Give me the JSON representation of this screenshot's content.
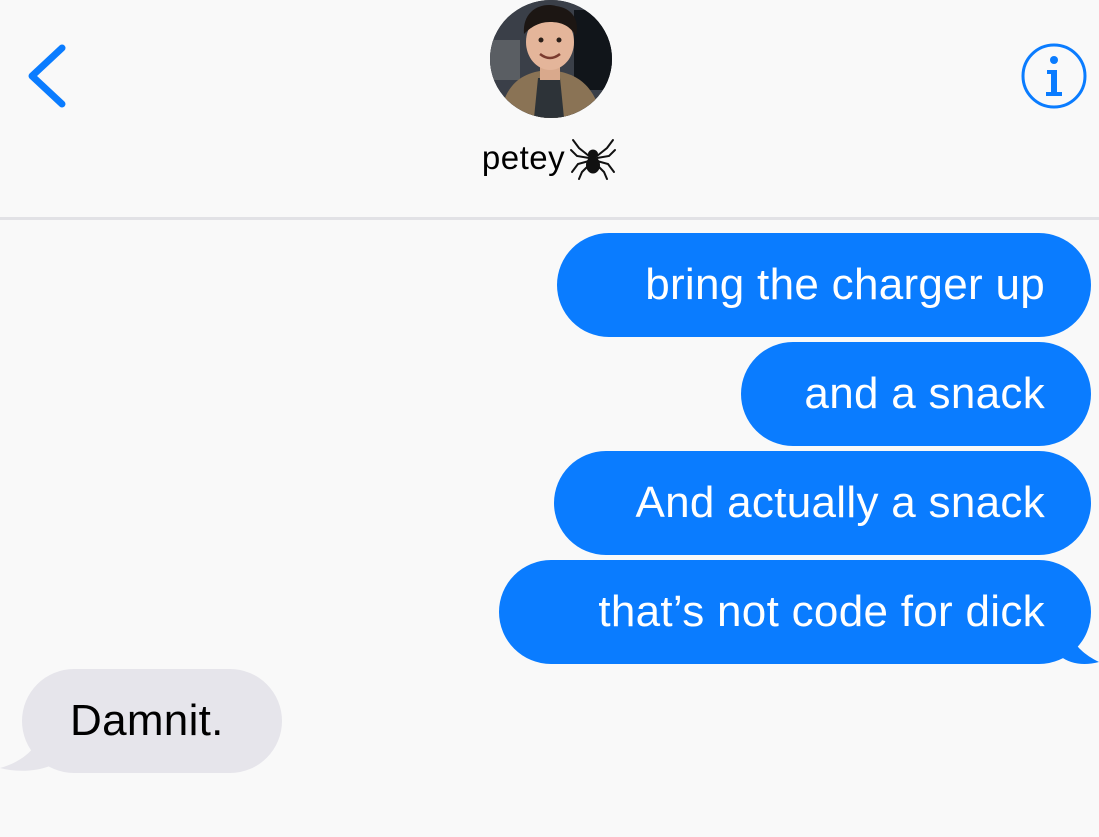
{
  "header": {
    "contact_name": "petey",
    "contact_emoji": "spider-emoji",
    "back_icon": "chevron-left-icon",
    "info_icon": "info-icon",
    "accent_color": "#0a7cff"
  },
  "messages": [
    {
      "direction": "outgoing",
      "text": "bring the charger up"
    },
    {
      "direction": "outgoing",
      "text": "and a snack"
    },
    {
      "direction": "outgoing",
      "text": "And actually a snack"
    },
    {
      "direction": "outgoing",
      "text": "that’s not code for dick"
    },
    {
      "direction": "incoming",
      "text": "Damnit."
    }
  ],
  "colors": {
    "outgoing_bubble": "#0a7cff",
    "incoming_bubble": "#e6e5eb",
    "background": "#f9f9f9"
  }
}
